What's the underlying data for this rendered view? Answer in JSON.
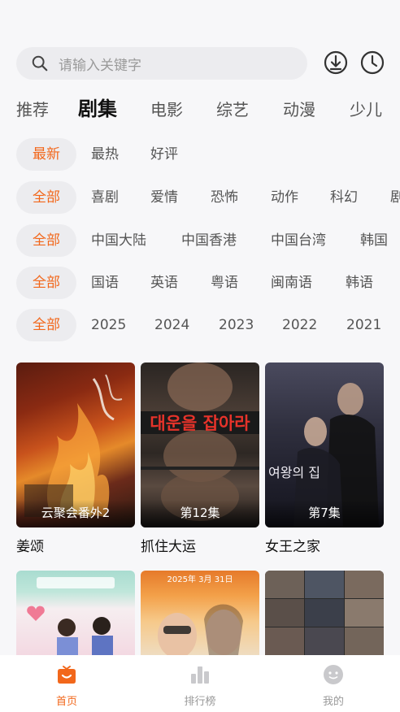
{
  "search": {
    "placeholder": "请输入关键字"
  },
  "header_icons": [
    "download-icon",
    "history-clock-icon"
  ],
  "tabs": [
    "推荐",
    "剧集",
    "电影",
    "综艺",
    "动漫",
    "少儿"
  ],
  "active_tab": "剧集",
  "filters": {
    "sort": [
      "最新",
      "最热",
      "好评"
    ],
    "genre": [
      "全部",
      "喜剧",
      "爱情",
      "恐怖",
      "动作",
      "科幻",
      "剧"
    ],
    "region": [
      "全部",
      "中国大陆",
      "中国香港",
      "中国台湾",
      "韩国"
    ],
    "language": [
      "全部",
      "国语",
      "英语",
      "粤语",
      "闽南语",
      "韩语"
    ],
    "year": [
      "全部",
      "2025",
      "2024",
      "2023",
      "2022",
      "2021"
    ]
  },
  "cards": [
    {
      "title": "姜颂",
      "badge": "云聚会番外2",
      "poster_text": ""
    },
    {
      "title": "抓住大运",
      "badge": "第12集",
      "poster_text": "대운을 잡아라"
    },
    {
      "title": "女王之家",
      "badge": "第7集",
      "poster_text": "여왕의 집"
    },
    {
      "title": "",
      "badge": "",
      "poster_text": ""
    },
    {
      "title": "",
      "badge": "",
      "poster_text": "2025年 3月 31日"
    },
    {
      "title": "",
      "badge": "",
      "poster_text": ""
    }
  ],
  "bottom_nav": [
    {
      "label": "首页",
      "icon": "home-icon"
    },
    {
      "label": "排行榜",
      "icon": "chart-icon"
    },
    {
      "label": "我的",
      "icon": "profile-icon"
    }
  ],
  "colors": {
    "accent": "#f2671b",
    "chip_bg": "#ececef",
    "page_bg": "#f7f7f9"
  }
}
